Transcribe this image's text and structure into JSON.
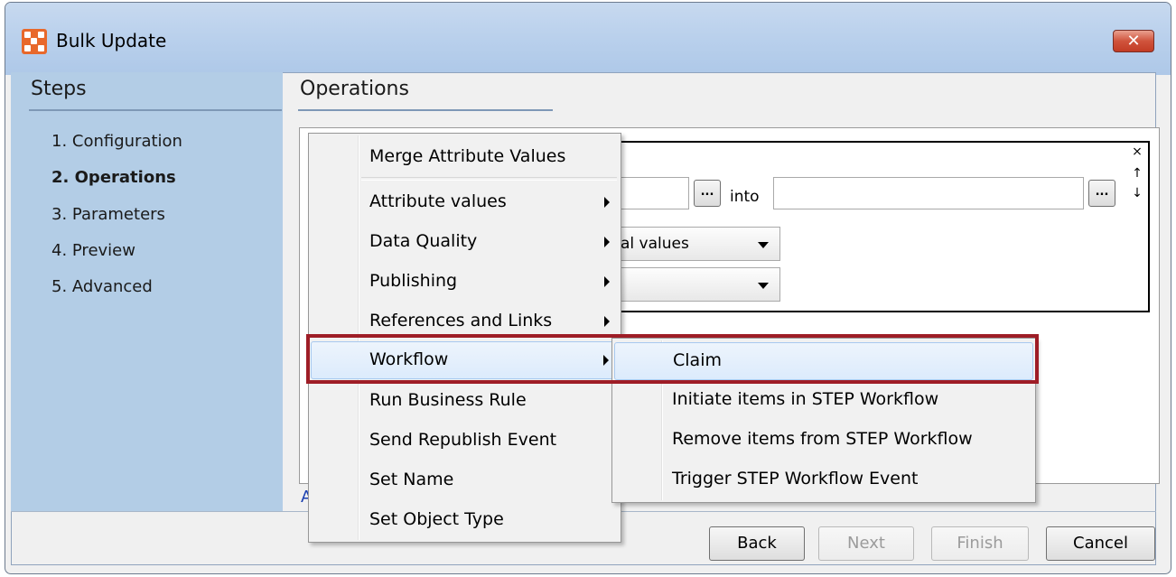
{
  "window": {
    "title": "Bulk Update",
    "close_glyph": "✕"
  },
  "steps": {
    "heading": "Steps",
    "items": [
      {
        "label": "1. Configuration",
        "active": false
      },
      {
        "label": "2. Operations",
        "active": true
      },
      {
        "label": "3. Parameters",
        "active": false
      },
      {
        "label": "4. Preview",
        "active": false
      },
      {
        "label": "5. Advanced",
        "active": false
      }
    ]
  },
  "operations": {
    "heading": "Operations",
    "into_label": "into",
    "browse_label": "...",
    "combo1_value": "al values",
    "combo2_value": "",
    "card_controls": {
      "remove": "⨯",
      "up": "↑",
      "down": "↓"
    },
    "link_stub": "A"
  },
  "context_menu": {
    "items": [
      {
        "label": "Merge Attribute Values",
        "submenu": false
      },
      {
        "label": "Attribute values",
        "submenu": true
      },
      {
        "label": "Data Quality",
        "submenu": true
      },
      {
        "label": "Publishing",
        "submenu": true
      },
      {
        "label": "References and Links",
        "submenu": true
      },
      {
        "label": "Workflow",
        "submenu": true
      },
      {
        "label": "Run Business Rule",
        "submenu": false
      },
      {
        "label": "Send Republish Event",
        "submenu": false
      },
      {
        "label": "Set Name",
        "submenu": false
      },
      {
        "label": "Set Object Type",
        "submenu": false
      }
    ]
  },
  "workflow_submenu": {
    "items": [
      {
        "label": "Claim"
      },
      {
        "label": "Initiate items in STEP Workflow"
      },
      {
        "label": "Remove items from STEP Workflow"
      },
      {
        "label": "Trigger STEP Workflow Event"
      }
    ]
  },
  "buttons": {
    "back": "Back",
    "next": "Next",
    "finish": "Finish",
    "cancel": "Cancel"
  },
  "colors": {
    "steps_panel": "#b3cde6",
    "highlight_frame": "#9e1d26",
    "app_icon": "#e8682b"
  }
}
